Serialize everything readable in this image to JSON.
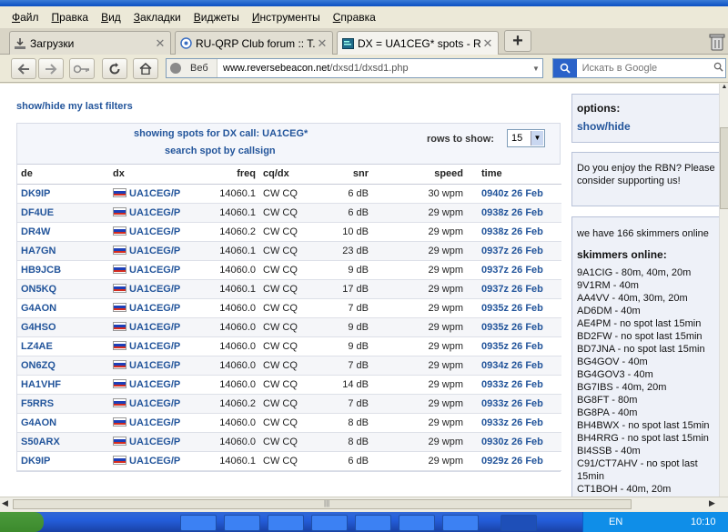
{
  "menu": [
    "Файл",
    "Правка",
    "Вид",
    "Закладки",
    "Виджеты",
    "Инструменты",
    "Справка"
  ],
  "tabs": [
    {
      "label": "Загрузки",
      "icon": "download-icon"
    },
    {
      "label": "RU-QRP Club forum :: T...",
      "icon": "globe-icon"
    },
    {
      "label": "DX = UA1CEG* spots - R...",
      "icon": "page-icon"
    }
  ],
  "nav": {
    "site_label": "Веб",
    "url_host": "www.reversebeacon.net",
    "url_path": "/dxsd1/dxsd1.php",
    "search_placeholder": "Искать в Google"
  },
  "page": {
    "filters_link": "show/hide my last filters",
    "showing": "showing spots for DX call: UA1CEG*",
    "search_spot": "search spot by callsign",
    "rows_label": "rows to show:",
    "rows_value": "15",
    "columns": [
      "de",
      "dx",
      "freq",
      "cq/dx",
      "snr",
      "speed",
      "time"
    ]
  },
  "spots": [
    {
      "de": "DK9IP",
      "dx": "UA1CEG/P",
      "freq": "14060.1",
      "mode": "CW CQ",
      "snr": "6 dB",
      "speed": "30 wpm",
      "time": "0940z 26 Feb"
    },
    {
      "de": "DF4UE",
      "dx": "UA1CEG/P",
      "freq": "14060.1",
      "mode": "CW CQ",
      "snr": "6 dB",
      "speed": "29 wpm",
      "time": "0938z 26 Feb"
    },
    {
      "de": "DR4W",
      "dx": "UA1CEG/P",
      "freq": "14060.2",
      "mode": "CW CQ",
      "snr": "10 dB",
      "speed": "29 wpm",
      "time": "0938z 26 Feb"
    },
    {
      "de": "HA7GN",
      "dx": "UA1CEG/P",
      "freq": "14060.1",
      "mode": "CW CQ",
      "snr": "23 dB",
      "speed": "29 wpm",
      "time": "0937z 26 Feb"
    },
    {
      "de": "HB9JCB",
      "dx": "UA1CEG/P",
      "freq": "14060.0",
      "mode": "CW CQ",
      "snr": "9 dB",
      "speed": "29 wpm",
      "time": "0937z 26 Feb"
    },
    {
      "de": "ON5KQ",
      "dx": "UA1CEG/P",
      "freq": "14060.1",
      "mode": "CW CQ",
      "snr": "17 dB",
      "speed": "29 wpm",
      "time": "0937z 26 Feb"
    },
    {
      "de": "G4AON",
      "dx": "UA1CEG/P",
      "freq": "14060.0",
      "mode": "CW CQ",
      "snr": "7 dB",
      "speed": "29 wpm",
      "time": "0935z 26 Feb"
    },
    {
      "de": "G4HSO",
      "dx": "UA1CEG/P",
      "freq": "14060.0",
      "mode": "CW CQ",
      "snr": "9 dB",
      "speed": "29 wpm",
      "time": "0935z 26 Feb"
    },
    {
      "de": "LZ4AE",
      "dx": "UA1CEG/P",
      "freq": "14060.0",
      "mode": "CW CQ",
      "snr": "9 dB",
      "speed": "29 wpm",
      "time": "0935z 26 Feb"
    },
    {
      "de": "ON6ZQ",
      "dx": "UA1CEG/P",
      "freq": "14060.0",
      "mode": "CW CQ",
      "snr": "7 dB",
      "speed": "29 wpm",
      "time": "0934z 26 Feb"
    },
    {
      "de": "HA1VHF",
      "dx": "UA1CEG/P",
      "freq": "14060.0",
      "mode": "CW CQ",
      "snr": "14 dB",
      "speed": "29 wpm",
      "time": "0933z 26 Feb"
    },
    {
      "de": "F5RRS",
      "dx": "UA1CEG/P",
      "freq": "14060.2",
      "mode": "CW CQ",
      "snr": "7 dB",
      "speed": "29 wpm",
      "time": "0933z 26 Feb"
    },
    {
      "de": "G4AON",
      "dx": "UA1CEG/P",
      "freq": "14060.0",
      "mode": "CW CQ",
      "snr": "8 dB",
      "speed": "29 wpm",
      "time": "0933z 26 Feb"
    },
    {
      "de": "S50ARX",
      "dx": "UA1CEG/P",
      "freq": "14060.0",
      "mode": "CW CQ",
      "snr": "8 dB",
      "speed": "29 wpm",
      "time": "0930z 26 Feb"
    },
    {
      "de": "DK9IP",
      "dx": "UA1CEG/P",
      "freq": "14060.1",
      "mode": "CW CQ",
      "snr": "6 dB",
      "speed": "29 wpm",
      "time": "0929z 26 Feb"
    }
  ],
  "side": {
    "options_title": "options:",
    "options_link": "show/hide",
    "support_text": "Do you enjoy the RBN? Please consider supporting us!",
    "skimmers_count": "we have 166 skimmers online",
    "skimmers_title": "skimmers online:",
    "skimmers": [
      "9A1CIG - 80m, 40m, 20m",
      "9V1RM - 40m",
      "AA4VV - 40m, 30m, 20m",
      "AD6DM - 40m",
      "AE4PM - no spot last 15min",
      "BD2FW - no spot last 15min",
      "BD7JNA - no spot last 15min",
      "BG4GOV - 40m",
      "BG4GOV3 - 40m",
      "BG7IBS - 40m, 20m",
      "BG8FT - 80m",
      "BG8PA - 40m",
      "BH4BWX - no spot last 15min",
      "BH4RRG - no spot last 15min",
      "BI4SSB - 40m",
      "C91/CT7AHV - no spot last 15min",
      "CT1BOH - 40m, 20m"
    ]
  },
  "taskbar": {
    "lang": "EN",
    "clock": "10:10"
  },
  "colors": {
    "link": "#23559b",
    "flag_white": "#ffffff",
    "flag_blue": "#1c3fb8",
    "flag_red": "#d52b1e"
  }
}
